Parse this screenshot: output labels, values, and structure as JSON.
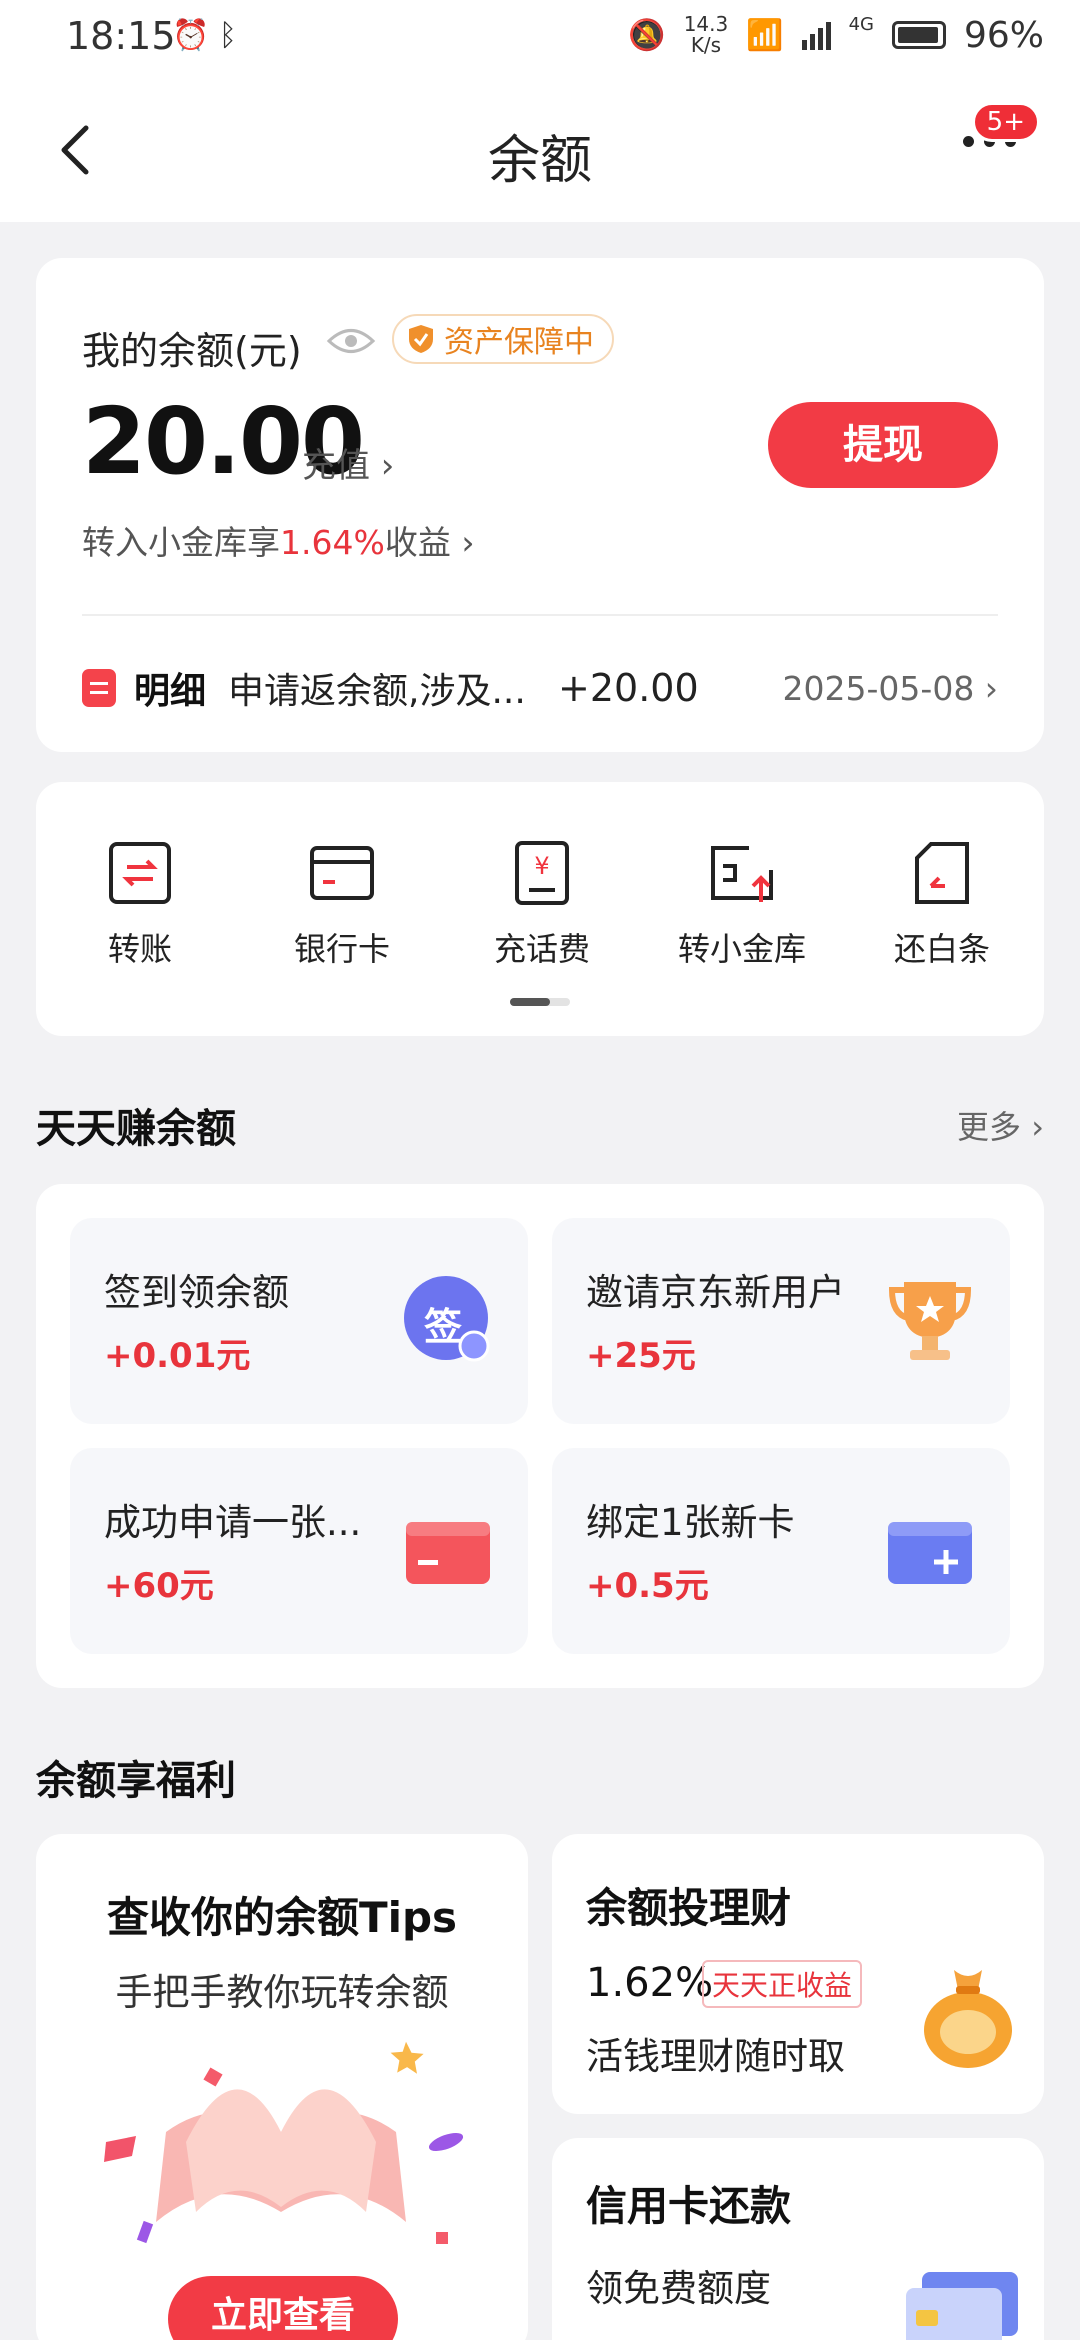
{
  "status_bar": {
    "time": "18:15",
    "net_speed_value": "14.3",
    "net_speed_unit": "K/s",
    "network_type": "4G",
    "battery": "96%"
  },
  "nav": {
    "title": "余额",
    "notification_badge": "5+"
  },
  "balance": {
    "label": "我的余额(元)",
    "guard_badge": "资产保障中",
    "amount": "20.00",
    "recharge_link": "充值 ›",
    "withdraw_button": "提现",
    "transfer_prefix": "转入小金库享",
    "transfer_rate": "1.64%",
    "transfer_suffix": "收益 ›",
    "detail": {
      "label": "明细",
      "description": "申请返余额,涉及...",
      "amount": "+20.00",
      "date": "2025-05-08 ›"
    }
  },
  "quick_actions": [
    {
      "label": "转账",
      "icon": "transfer-icon"
    },
    {
      "label": "银行卡",
      "icon": "bank-card-icon"
    },
    {
      "label": "充话费",
      "icon": "phone-topup-icon"
    },
    {
      "label": "转小金库",
      "icon": "vault-icon"
    },
    {
      "label": "还白条",
      "icon": "repay-icon"
    }
  ],
  "earn_section": {
    "title": "天天赚余额",
    "more": "更多 ›",
    "tasks": [
      {
        "title": "签到领余额",
        "reward": "+0.01元",
        "icon": "sign-in-icon",
        "icon_text": "签"
      },
      {
        "title": "邀请京东新用户",
        "reward": "+25元",
        "icon": "trophy-icon"
      },
      {
        "title": "成功申请一张...",
        "reward": "+60元",
        "icon": "red-card-icon"
      },
      {
        "title": "绑定1张新卡",
        "reward": "+0.5元",
        "icon": "add-card-icon"
      }
    ]
  },
  "benefits_section": {
    "title": "余额享福利",
    "tips": {
      "title": "查收你的余额Tips",
      "subtitle": "手把手教你玩转余额",
      "button": "立即查看"
    },
    "finance": {
      "title": "余额投理财",
      "rate": "1.62%",
      "tag": "天天正收益",
      "description": "活钱理财随时取"
    },
    "credit": {
      "title": "信用卡还款",
      "description": "领免费额度"
    }
  },
  "colors": {
    "accent_red": "#f23b45",
    "guard_orange": "#e88320",
    "background": "#f2f2f4"
  }
}
